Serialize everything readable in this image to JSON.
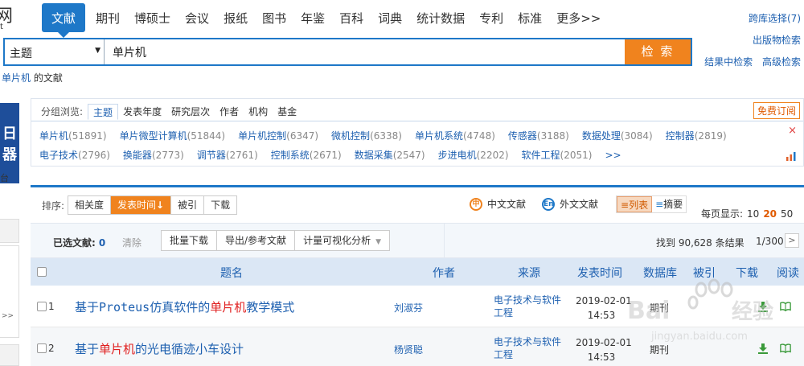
{
  "logo": {
    "line1": "网",
    "line2": "t"
  },
  "nav": {
    "items": [
      "文献",
      "期刊",
      "博硕士",
      "会议",
      "报纸",
      "图书",
      "年鉴",
      "百科",
      "词典",
      "统计数据",
      "专利",
      "标准",
      "更多>>"
    ]
  },
  "top_right": {
    "cross_db": "跨库选择(7)",
    "publication_search": "出版物检索",
    "in_results": "结果中检索",
    "advanced": "高级检索"
  },
  "search": {
    "field": "主题",
    "query": "单片机",
    "button": "检 索"
  },
  "crumb": {
    "keyword": "单片机",
    "suffix": " 的文献"
  },
  "left_fragments": {
    "a": "日",
    "b": "器",
    "c": "台",
    "d": ">>"
  },
  "group": {
    "label": "分组浏览:",
    "tabs": [
      "主题",
      "发表年度",
      "研究层次",
      "作者",
      "机构",
      "基金"
    ],
    "free_subscribe": "免费订阅",
    "close": "×",
    "terms": [
      {
        "name": "单片机",
        "count": "(51891)"
      },
      {
        "name": "单片微型计算机",
        "count": "(51844)"
      },
      {
        "name": "单片机控制",
        "count": "(6347)"
      },
      {
        "name": "微机控制",
        "count": "(6338)"
      },
      {
        "name": "单片机系统",
        "count": "(4748)"
      },
      {
        "name": "传感器",
        "count": "(3188)"
      },
      {
        "name": "数据处理",
        "count": "(3084)"
      },
      {
        "name": "控制器",
        "count": "(2819)"
      },
      {
        "name": "电子技术",
        "count": "(2796)"
      },
      {
        "name": "换能器",
        "count": "(2773)"
      },
      {
        "name": "调节器",
        "count": "(2761)"
      },
      {
        "name": "控制系统",
        "count": "(2671)"
      },
      {
        "name": "数据采集",
        "count": "(2547)"
      },
      {
        "name": "步进电机",
        "count": "(2202)"
      },
      {
        "name": "软件工程",
        "count": "(2051)"
      },
      {
        "name": ">>",
        "count": ""
      }
    ]
  },
  "sort": {
    "label": "排序:",
    "options": [
      "相关度",
      "发表时间",
      "被引",
      "下载"
    ],
    "active_arrow": "↓"
  },
  "lang": {
    "cn": "中文文献",
    "en": "外文文献",
    "cn_icon": "中",
    "en_icon": "En"
  },
  "view": {
    "list": "列表",
    "abstract": "摘要",
    "list_icon": "≡",
    "abstract_icon": "≡"
  },
  "per_page": {
    "label": "每页显示:",
    "options": [
      "10",
      "20",
      "50"
    ],
    "selected": "20"
  },
  "selection": {
    "label": "已选文献:",
    "count": "0",
    "clear": "清除",
    "actions": [
      "批量下载",
      "导出/参考文献",
      "计量可视化分析"
    ],
    "dropdown": "▼"
  },
  "found": "找到 90,628 条结果",
  "pager": "1/300",
  "pager_next": ">",
  "table": {
    "headers": [
      "题名",
      "作者",
      "来源",
      "发表时间",
      "数据库",
      "被引",
      "下载",
      "阅读"
    ],
    "rows": [
      {
        "num": "1",
        "title_pre": "基于Proteus仿真软件的",
        "title_hl": "单片机",
        "title_post": "教学模式",
        "author": "刘淑芬",
        "source": "电子技术与软件工程",
        "date": "2019-02-01",
        "time": "14:53",
        "db": "期刊"
      },
      {
        "num": "2",
        "title_pre": "基于",
        "title_hl": "单片机",
        "title_post": "的光电循迹小车设计",
        "author": "杨贤聪",
        "source": "电子技术与软件工程",
        "date": "2019-02-01",
        "time": "14:53",
        "db": "期刊"
      }
    ]
  },
  "watermark": {
    "brand": "Bai",
    "brand_cn": "经验",
    "url": "jingyan.baidu.com"
  },
  "colors": {
    "accent": "#1e78c8",
    "orange": "#f0831e",
    "link": "#1e60b0",
    "highlight": "#e02020"
  },
  "icons": {
    "download": "download-icon",
    "read": "book-icon",
    "lang_cn": "chinese-globe-icon",
    "lang_en": "english-globe-icon",
    "stats": "bar-chart-icon"
  }
}
